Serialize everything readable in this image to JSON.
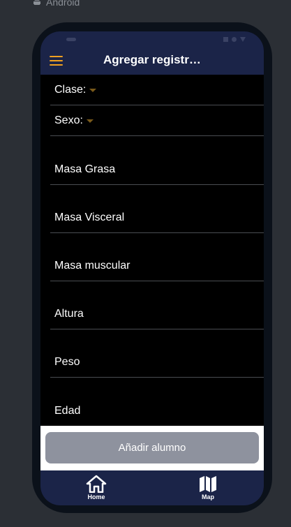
{
  "platform": {
    "label": "Android",
    "icon": "android-icon"
  },
  "app_bar": {
    "title": "Agregar registr…",
    "menu_icon": "hamburger-menu-icon",
    "accent": "#f0a020",
    "background": "#1b2448"
  },
  "form": {
    "selects": [
      {
        "label": "Clase:"
      },
      {
        "label": "Sexo:"
      }
    ],
    "fields": [
      {
        "label": "Masa Grasa"
      },
      {
        "label": "Masa Visceral"
      },
      {
        "label": "Masa muscular"
      },
      {
        "label": "Altura"
      },
      {
        "label": "Peso"
      },
      {
        "label": "Edad"
      }
    ]
  },
  "actions": {
    "add_student": "Añadir alumno"
  },
  "bottom_nav": {
    "items": [
      {
        "label": "Home",
        "icon": "home-icon"
      },
      {
        "label": "Map",
        "icon": "map-icon"
      }
    ]
  }
}
